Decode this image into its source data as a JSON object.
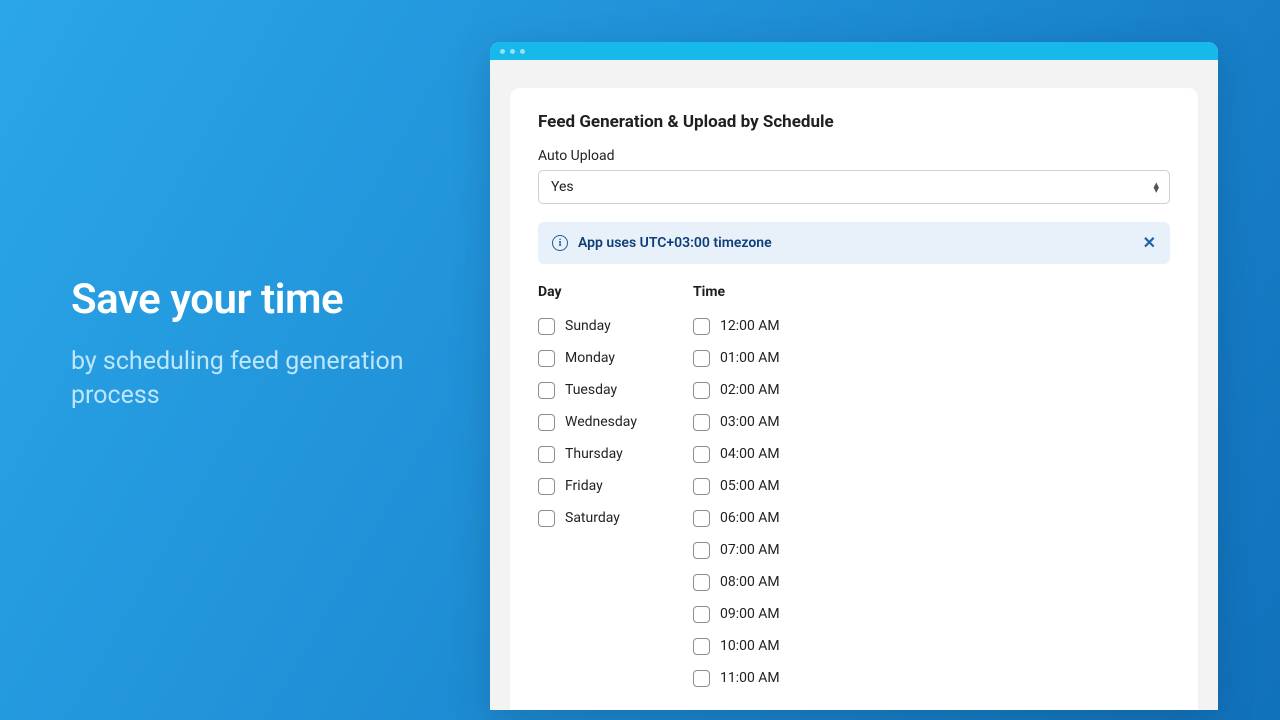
{
  "promo": {
    "headline": "Save your time",
    "subline": "by scheduling feed generation process"
  },
  "card": {
    "title": "Feed Generation & Upload by Schedule",
    "auto_upload_label": "Auto Upload",
    "auto_upload_value": "Yes",
    "banner_text": "App uses UTC+03:00 timezone",
    "day_header": "Day",
    "time_header": "Time",
    "days": [
      "Sunday",
      "Monday",
      "Tuesday",
      "Wednesday",
      "Thursday",
      "Friday",
      "Saturday"
    ],
    "times": [
      "12:00 AM",
      "01:00 AM",
      "02:00 AM",
      "03:00 AM",
      "04:00 AM",
      "05:00 AM",
      "06:00 AM",
      "07:00 AM",
      "08:00 AM",
      "09:00 AM",
      "10:00 AM",
      "11:00 AM"
    ]
  }
}
